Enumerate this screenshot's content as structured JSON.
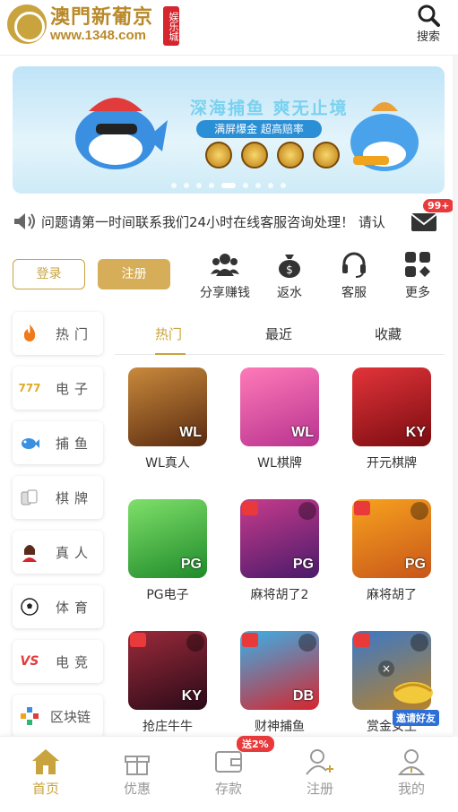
{
  "header": {
    "logo_title": "澳門新葡京",
    "logo_url": "www.1348.com",
    "logo_badge": "娱乐城",
    "search_label": "搜索"
  },
  "banner": {
    "headline": "深海捕鱼 爽无止境",
    "subline": "满屏爆金 超高赔率",
    "slides": 9,
    "active_slide": 5
  },
  "notice": {
    "text": "问题请第一时间联系我们24小时在线客服咨询处理！ 请认",
    "unread_badge": "99+"
  },
  "auth": {
    "login_label": "登录",
    "register_label": "注册"
  },
  "quick_links": [
    {
      "label": "分享赚钱",
      "icon": "share-earn-icon"
    },
    {
      "label": "返水",
      "icon": "money-bag-icon"
    },
    {
      "label": "客服",
      "icon": "headset-icon"
    },
    {
      "label": "更多",
      "icon": "grid-more-icon"
    }
  ],
  "categories": [
    {
      "label": "热门",
      "icon": "flame-icon"
    },
    {
      "label": "电子",
      "icon": "slot-777-icon"
    },
    {
      "label": "捕鱼",
      "icon": "fish-icon"
    },
    {
      "label": "棋牌",
      "icon": "cards-icon"
    },
    {
      "label": "真人",
      "icon": "live-dealer-icon"
    },
    {
      "label": "体育",
      "icon": "soccer-ball-icon"
    },
    {
      "label": "电竞",
      "icon": "vs-esports-icon"
    },
    {
      "label": "区块链",
      "icon": "blockchain-icon"
    }
  ],
  "tabs": [
    {
      "label": "热门",
      "active": true
    },
    {
      "label": "最近",
      "active": false
    },
    {
      "label": "收藏",
      "active": false
    }
  ],
  "games": [
    {
      "name": "WL真人",
      "mark": "WL"
    },
    {
      "name": "WL棋牌",
      "mark": "WL"
    },
    {
      "name": "开元棋牌",
      "mark": "KY"
    },
    {
      "name": "PG电子",
      "mark": "PG"
    },
    {
      "name": "麻将胡了2",
      "mark": "PG"
    },
    {
      "name": "麻将胡了",
      "mark": "PG"
    },
    {
      "name": "抢庄牛牛",
      "mark": "KY"
    },
    {
      "name": "财神捕鱼",
      "mark": "DB"
    },
    {
      "name": "赏金女王",
      "mark": ""
    }
  ],
  "invite": {
    "label": "邀请好友",
    "close": "×"
  },
  "bottom_nav": [
    {
      "label": "首页",
      "icon": "home-icon",
      "active": true
    },
    {
      "label": "优惠",
      "icon": "gift-icon",
      "active": false
    },
    {
      "label": "存款",
      "icon": "wallet-icon",
      "active": false,
      "badge": "送2%"
    },
    {
      "label": "注册",
      "icon": "add-user-icon",
      "active": false
    },
    {
      "label": "我的",
      "icon": "profile-icon",
      "active": false
    }
  ],
  "colors": {
    "accent": "#c9a33e",
    "button_gold": "#d6ae5a",
    "badge_red": "#e8393b"
  }
}
